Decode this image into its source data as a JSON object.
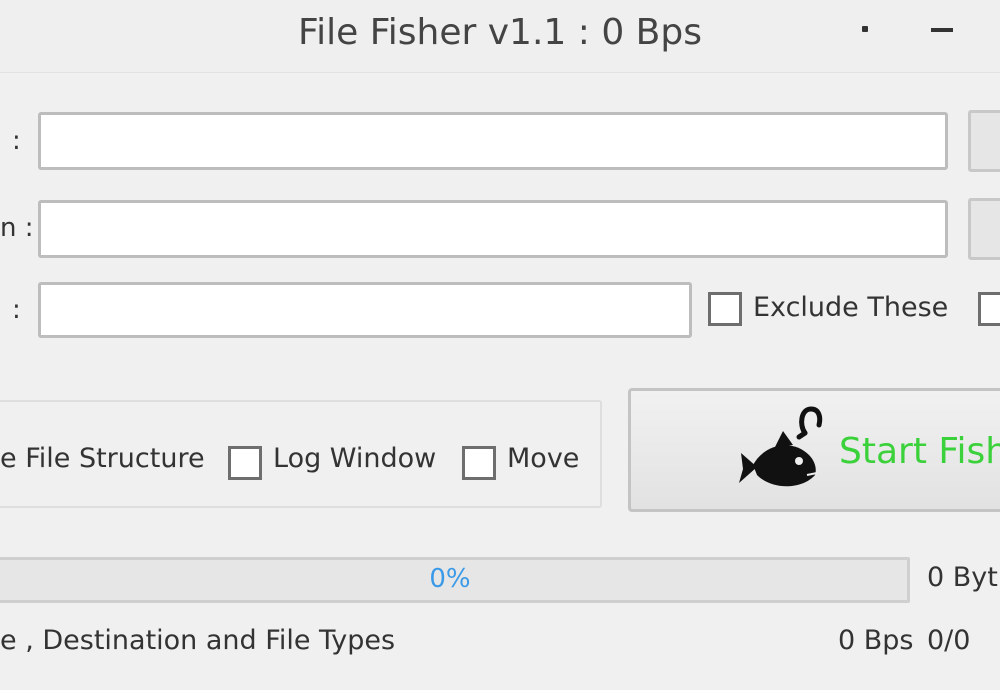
{
  "window": {
    "title": "File Fisher v1.1 : 0 Bps"
  },
  "form": {
    "rows": [
      {
        "colon": ":",
        "value": ""
      },
      {
        "colon": "n :",
        "value": ""
      },
      {
        "colon": ":",
        "value": ""
      }
    ],
    "exclude_label": "Exclude These"
  },
  "options": {
    "file_structure_label": "e File Structure",
    "log_window_label": "Log Window",
    "move_label": "Move"
  },
  "start_button": {
    "label": "Start Fishi",
    "icon": "fish-hook-icon"
  },
  "progress": {
    "percent": 0,
    "text": "0%",
    "bytes_text": "0 Byt"
  },
  "status": {
    "message": "e , Destination and File Types",
    "speed": "0 Bps",
    "count": "0/0"
  },
  "colors": {
    "start_label": "#3bd13b",
    "progress_text": "#3b9ae8",
    "progress_fill": "#06b025"
  }
}
